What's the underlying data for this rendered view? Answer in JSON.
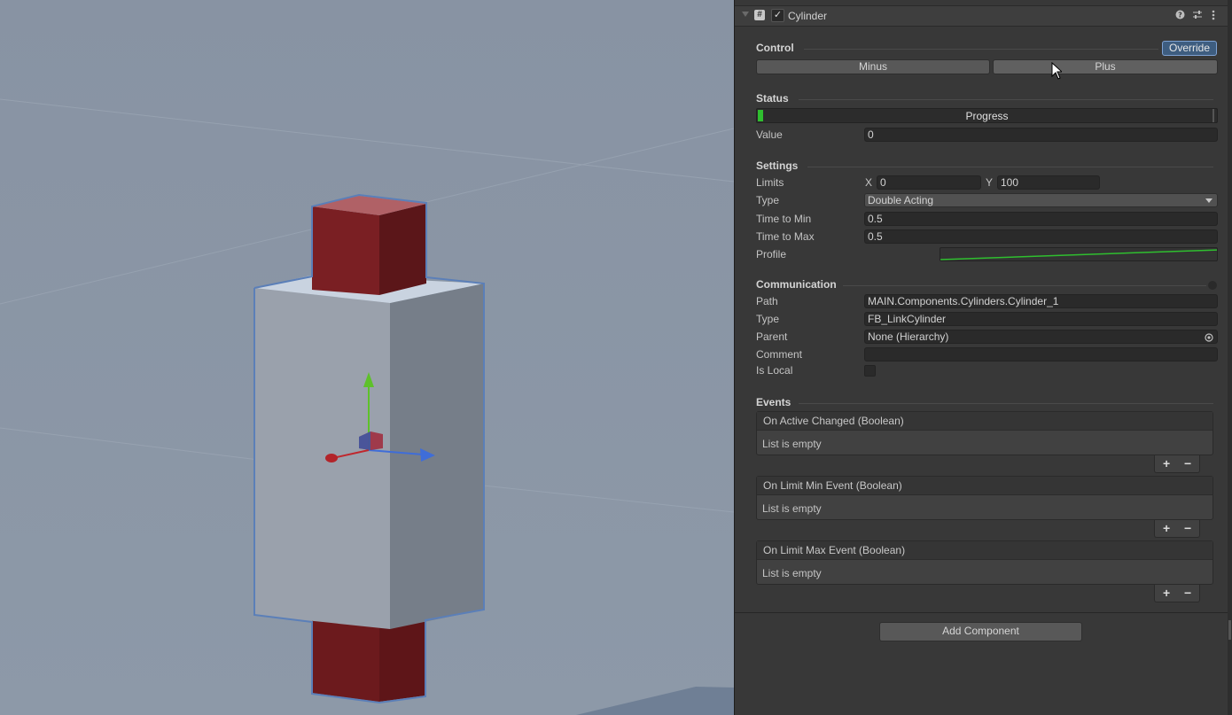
{
  "component": {
    "title": "Cylinder",
    "enabled_mark": "✓"
  },
  "control": {
    "heading": "Control",
    "override_label": "Override",
    "minus_label": "Minus",
    "plus_label": "Plus"
  },
  "status": {
    "heading": "Status",
    "progress_label": "Progress",
    "progress_fraction": 0.0,
    "value_label": "Value",
    "value": "0"
  },
  "settings": {
    "heading": "Settings",
    "limits_label": "Limits",
    "x_label": "X",
    "x_value": "0",
    "y_label": "Y",
    "y_value": "100",
    "type_label": "Type",
    "type_value": "Double Acting",
    "time_to_min_label": "Time to Min",
    "time_to_min": "0.5",
    "time_to_max_label": "Time to Max",
    "time_to_max": "0.5",
    "profile_label": "Profile"
  },
  "communication": {
    "heading": "Communication",
    "path_label": "Path",
    "path_value": "MAIN.Components.Cylinders.Cylinder_1",
    "type_label": "Type",
    "type_value": "FB_LinkCylinder",
    "parent_label": "Parent",
    "parent_value": "None (Hierarchy)",
    "comment_label": "Comment",
    "comment_value": "",
    "is_local_label": "Is Local"
  },
  "events": {
    "heading": "Events",
    "list": [
      {
        "name": "On Active Changed (Boolean)",
        "empty": "List is empty"
      },
      {
        "name": "On Limit Min Event (Boolean)",
        "empty": "List is empty"
      },
      {
        "name": "On Limit Max Event (Boolean)",
        "empty": "List is empty"
      }
    ],
    "plus": "+",
    "minus": "−"
  },
  "add_component_label": "Add Component",
  "colors": {
    "inspector_bg": "#383838",
    "override_accent": "#3e5d80",
    "progress_green": "#2fbf2f",
    "cylinder_red": "#7a1f23"
  }
}
